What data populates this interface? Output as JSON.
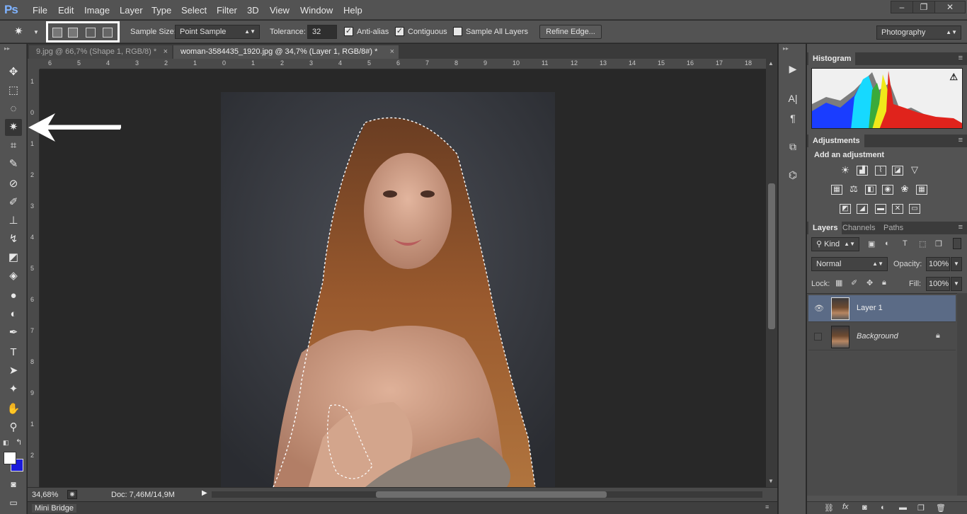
{
  "app": {
    "logo": "Ps"
  },
  "menubar": {
    "items": [
      "File",
      "Edit",
      "Image",
      "Layer",
      "Type",
      "Select",
      "Filter",
      "3D",
      "View",
      "Window",
      "Help"
    ],
    "window_controls": [
      "minimize-icon",
      "restore-icon",
      "close-icon"
    ]
  },
  "options": {
    "sample_size_label": "Sample Size:",
    "sample_size_value": "Point Sample",
    "tolerance_label": "Tolerance:",
    "tolerance_value": "32",
    "anti_alias_label": "Anti-alias",
    "anti_alias_checked": true,
    "contiguous_label": "Contiguous",
    "contiguous_checked": true,
    "sample_all_layers_label": "Sample All Layers",
    "sample_all_layers_checked": false,
    "refine_edge_label": "Refine Edge...",
    "workspace_value": "Photography"
  },
  "tabs": [
    {
      "label": "9.jpg @ 66,7% (Shape 1, RGB/8) *",
      "active": false
    },
    {
      "label": "woman-3584435_1920.jpg @ 34,7% (Layer 1, RGB/8#) *",
      "active": true
    }
  ],
  "ruler": {
    "h": [
      "6",
      "5",
      "4",
      "3",
      "2",
      "1",
      "0",
      "1",
      "2",
      "3",
      "4",
      "5",
      "6",
      "7",
      "8",
      "9",
      "10",
      "11",
      "12",
      "13",
      "14",
      "15",
      "16",
      "17",
      "18"
    ],
    "v": [
      "1",
      "0",
      "1",
      "2",
      "3",
      "4",
      "5",
      "6",
      "7",
      "8",
      "9",
      "1",
      "2"
    ]
  },
  "status": {
    "zoom": "34,68%",
    "doc": "Doc: 7,46M/14,9M"
  },
  "minibridge": {
    "label": "Mini Bridge"
  },
  "histogram": {
    "tab": "Histogram"
  },
  "adjustments": {
    "tab": "Adjustments",
    "heading": "Add an adjustment"
  },
  "layers_panel": {
    "tabs": [
      "Layers",
      "Channels",
      "Paths"
    ],
    "kind_label": "Kind",
    "blend_mode": "Normal",
    "opacity_label": "Opacity:",
    "opacity_value": "100%",
    "lock_label": "Lock:",
    "fill_label": "Fill:",
    "fill_value": "100%",
    "layers": [
      {
        "name": "Layer 1",
        "visible": true,
        "selected": true
      },
      {
        "name": "Background",
        "visible": false,
        "selected": false,
        "locked": true
      }
    ]
  },
  "colors": {
    "accent_selected_layer": "#5b6b86",
    "background_swatch": "#1a1adb",
    "foreground_swatch": "#ffffff"
  }
}
